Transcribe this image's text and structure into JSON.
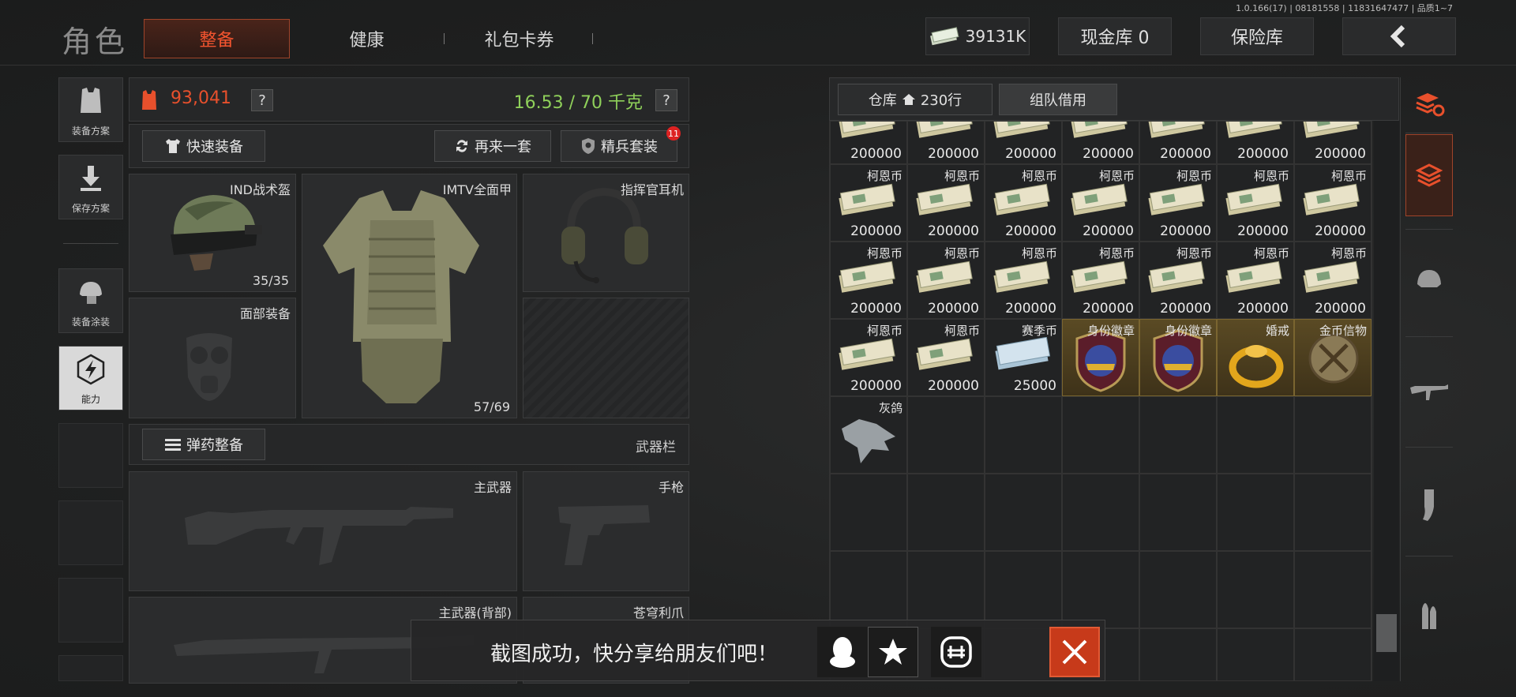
{
  "version": "1.0.166(17) | 08181558 | 11831647477 | 品质1~7",
  "header": {
    "title": "角色",
    "tabs": [
      "整备",
      "健康",
      "礼包卡券"
    ],
    "money": "39131K",
    "cash_vault": "现金库 0",
    "insurance": "保险库"
  },
  "sidebar": [
    "装备方案",
    "保存方案",
    "装备涂装",
    "能力"
  ],
  "loadout": {
    "value": "93,041",
    "weight": "16.53 / 70 千克",
    "help": "?",
    "quick_equip": "快速装备",
    "again": "再来一套",
    "elite": "精兵套装",
    "elite_badge": "11",
    "helmet": {
      "name": "IND战术盔",
      "durability": "35/35"
    },
    "armor": {
      "name": "IMTV全面甲",
      "durability": "57/69"
    },
    "headset": {
      "name": "指挥官耳机"
    },
    "face": {
      "name": "面部装备"
    },
    "ammo_btn": "弹药整备",
    "weapon_bar": "武器栏",
    "primary": "主武器",
    "pistol": "手枪",
    "primary_back": "主武器(背部)",
    "melee": "苍穹利爪"
  },
  "inventory": {
    "tab_label": "仓库",
    "rows": "230行",
    "team_borrow": "组队借用",
    "row0_values": [
      "200000",
      "200000",
      "200000",
      "200000",
      "200000",
      "200000",
      "200000"
    ],
    "row1": [
      {
        "l": "柯恩币",
        "v": "200000"
      },
      {
        "l": "柯恩币",
        "v": "200000"
      },
      {
        "l": "柯恩币",
        "v": "200000"
      },
      {
        "l": "柯恩币",
        "v": "200000"
      },
      {
        "l": "柯恩币",
        "v": "200000"
      },
      {
        "l": "柯恩币",
        "v": "200000"
      },
      {
        "l": "柯恩币",
        "v": "200000"
      }
    ],
    "row2": [
      {
        "l": "柯恩币",
        "v": "200000"
      },
      {
        "l": "柯恩币",
        "v": "200000"
      },
      {
        "l": "柯恩币",
        "v": "200000"
      },
      {
        "l": "柯恩币",
        "v": "200000"
      },
      {
        "l": "柯恩币",
        "v": "200000"
      },
      {
        "l": "柯恩币",
        "v": "200000"
      },
      {
        "l": "柯恩币",
        "v": "200000"
      }
    ],
    "row3": [
      {
        "l": "柯恩币",
        "v": "200000"
      },
      {
        "l": "柯恩币",
        "v": "200000"
      },
      {
        "l": "赛季币",
        "v": "25000"
      },
      {
        "l": "身份徽章",
        "v": ""
      },
      {
        "l": "身份徽章",
        "v": ""
      },
      {
        "l": "婚戒",
        "v": ""
      },
      {
        "l": "金币信物",
        "v": ""
      }
    ],
    "row4": [
      {
        "l": "灰鸽",
        "v": ""
      }
    ]
  },
  "toast": {
    "text": "截图成功，快分享给朋友们吧！"
  }
}
